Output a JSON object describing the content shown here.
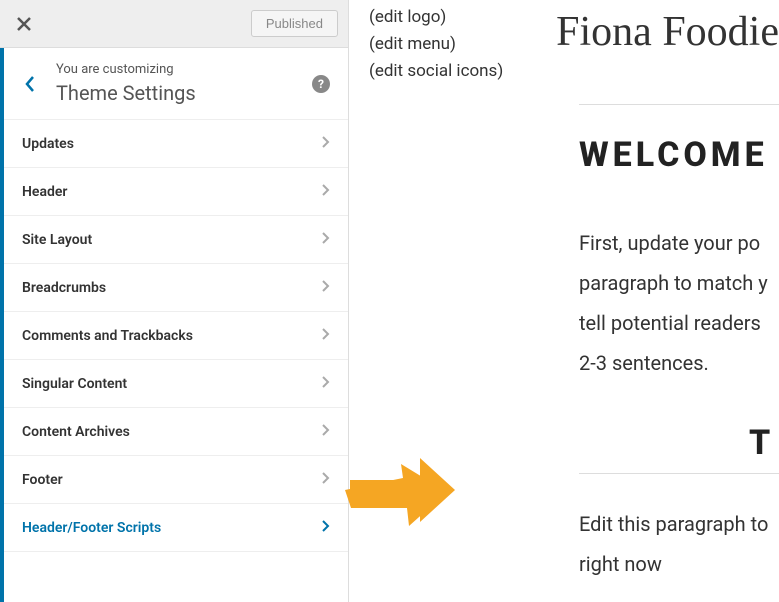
{
  "topbar": {
    "published_label": "Published"
  },
  "header": {
    "customizing_label": "You are customizing",
    "section_title": "Theme Settings"
  },
  "menu": {
    "items": [
      {
        "label": "Updates",
        "highlighted": false
      },
      {
        "label": "Header",
        "highlighted": false
      },
      {
        "label": "Site Layout",
        "highlighted": false
      },
      {
        "label": "Breadcrumbs",
        "highlighted": false
      },
      {
        "label": "Comments and Trackbacks",
        "highlighted": false
      },
      {
        "label": "Singular Content",
        "highlighted": false
      },
      {
        "label": "Content Archives",
        "highlighted": false
      },
      {
        "label": "Footer",
        "highlighted": false
      },
      {
        "label": "Header/Footer Scripts",
        "highlighted": true
      }
    ]
  },
  "preview": {
    "edit_logo": "(edit logo)",
    "edit_menu": "(edit menu)",
    "edit_social": "(edit social icons)",
    "brand": "Fiona Foodie",
    "welcome_title": "WELCOME",
    "body1_line1": "First, update your po",
    "body1_line2": "paragraph to match y",
    "body1_line3": "tell potential readers",
    "body1_line4": "2-3 sentences.",
    "section_t": "T",
    "body2_line1": "Edit this paragraph to",
    "body2_line2": "right now"
  }
}
